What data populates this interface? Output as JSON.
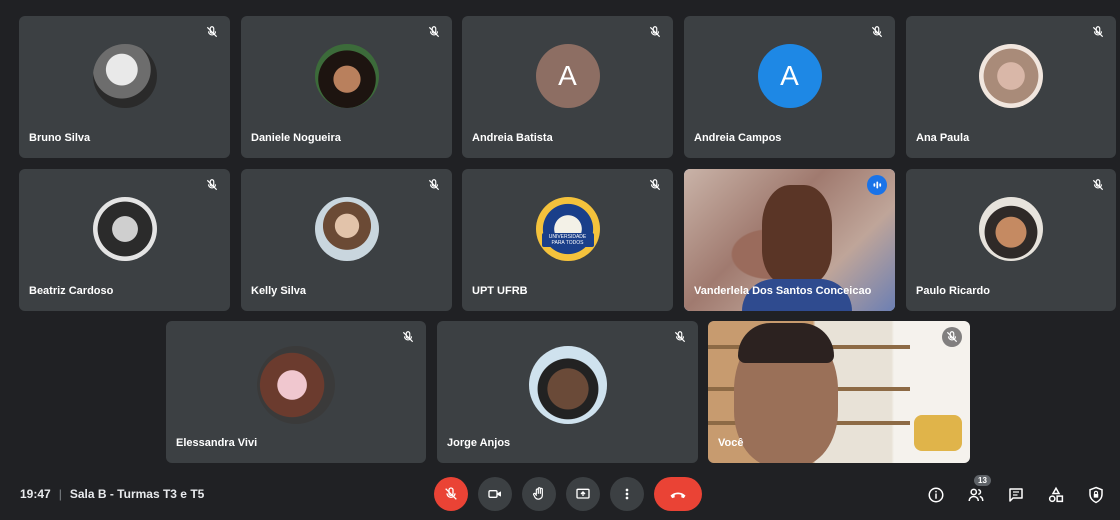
{
  "participants": [
    {
      "name": "Bruno Silva",
      "avatar": "photo"
    },
    {
      "name": "Daniele Nogueira",
      "avatar": "photo"
    },
    {
      "name": "Andreia Batista",
      "avatar": "letter",
      "letter": "A",
      "color": "#8d6e63"
    },
    {
      "name": "Andreia Campos",
      "avatar": "letter",
      "letter": "A",
      "color": "#1e88e5"
    },
    {
      "name": "Ana Paula",
      "avatar": "photo"
    },
    {
      "name": "Beatriz Cardoso",
      "avatar": "photo"
    },
    {
      "name": "Kelly Silva",
      "avatar": "photo"
    },
    {
      "name": "UPT UFRB",
      "avatar": "photo",
      "sticker_text": "UNIVERSIDADE PARA TODOS"
    },
    {
      "name": "Vanderlela Dos Santos Conceicao",
      "avatar": "video",
      "speaking": true
    },
    {
      "name": "Paulo Ricardo",
      "avatar": "photo"
    },
    {
      "name": "Elessandra Vivi",
      "avatar": "photo"
    },
    {
      "name": "Jorge Anjos",
      "avatar": "photo"
    },
    {
      "name": "Você",
      "avatar": "video",
      "self": true
    }
  ],
  "meeting": {
    "time": "19:47",
    "separator": "|",
    "title": "Sala B - Turmas T3 e T5"
  },
  "controls": [
    {
      "icon": "mic-off-icon",
      "state": "muted"
    },
    {
      "icon": "camera-icon"
    },
    {
      "icon": "raise-hand-icon"
    },
    {
      "icon": "present-screen-icon"
    },
    {
      "icon": "more-options-icon"
    },
    {
      "icon": "hang-up-icon"
    }
  ],
  "side_panel": {
    "people_count": "13",
    "icons": [
      "info-icon",
      "people-icon",
      "chat-icon",
      "activities-icon",
      "host-controls-icon"
    ]
  },
  "colors": {
    "background": "#202124",
    "tile": "#3c4043",
    "accent": "#8ab4f8",
    "danger": "#ea4335"
  }
}
